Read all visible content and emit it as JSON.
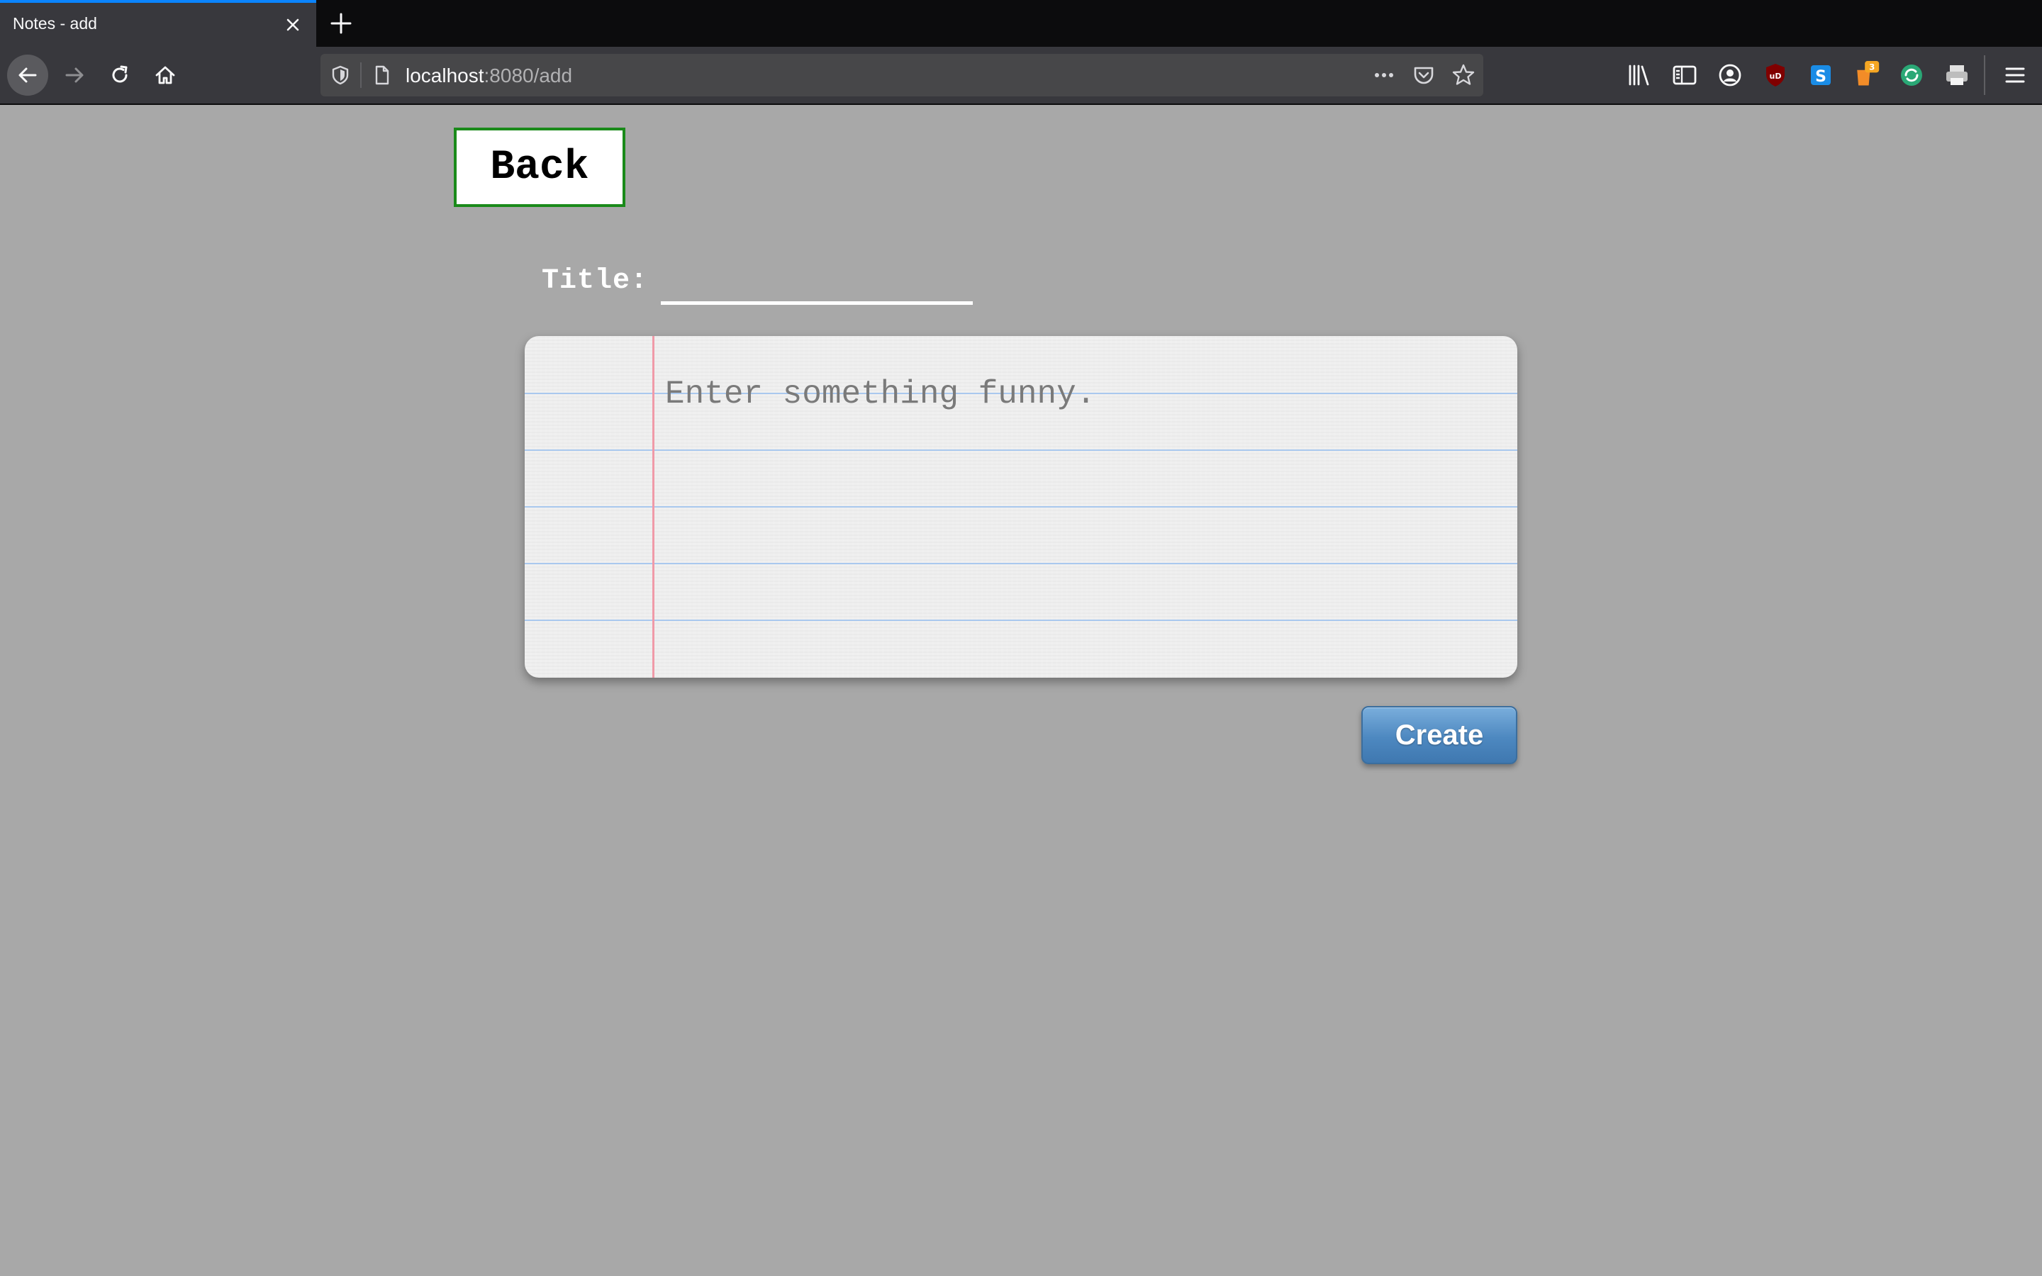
{
  "browser": {
    "tab_title": "Notes - add",
    "url_host": "localhost",
    "url_rest": ":8080/add",
    "accent_color": "#0a84ff",
    "extension_badge": "3",
    "extension_letter": "S",
    "ublock_label": "uD"
  },
  "page": {
    "back_label": "Back",
    "title_label": "Title:",
    "title_value": "",
    "note_placeholder": "Enter something funny.",
    "note_value": "",
    "create_label": "Create",
    "colors": {
      "background": "#a8a8a8",
      "back_border": "#1a8a1a",
      "paper_rule": "#a9c8ee",
      "paper_margin": "#f09aa8",
      "create_button": "#4d88c0"
    }
  }
}
